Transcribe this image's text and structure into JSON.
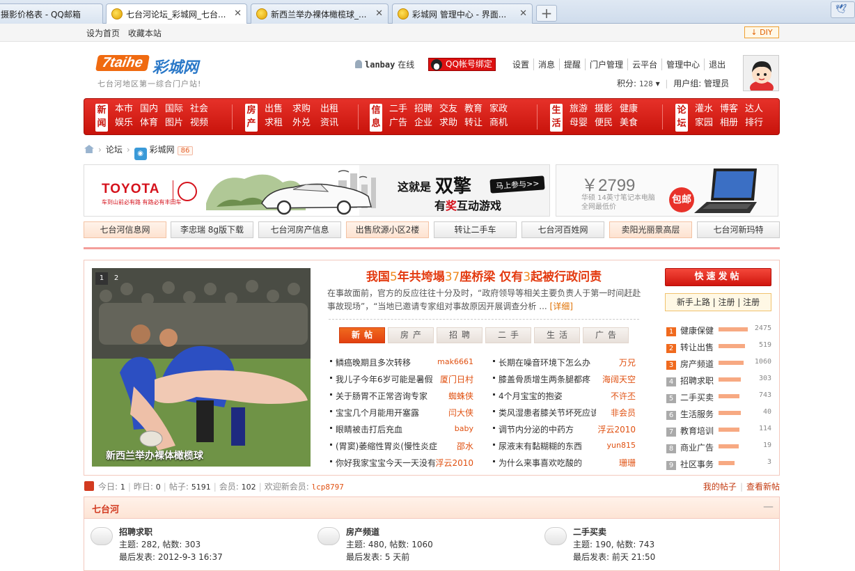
{
  "browser": {
    "tabs": [
      {
        "title": "摄影价格表 - QQ邮箱"
      },
      {
        "title": "七台河论坛_彩城网_七台..."
      },
      {
        "title": "新西兰举办裸体橄榄球_..."
      },
      {
        "title": "彩城网 管理中心 - 界面..."
      }
    ],
    "new_tab": "+"
  },
  "topbar": {
    "set_home": "设为首页",
    "bookmark": "收藏本站",
    "diy": "DIY"
  },
  "header": {
    "logo_brand": "7taihe",
    "logo_cn": "彩城网",
    "slogan": "七台河地区第一综合门户站!",
    "username": "lanbay",
    "status": "在线",
    "qq_bind": "QQ帐号绑定",
    "nav_links": [
      "设置",
      "消息",
      "提醒",
      "门户管理",
      "云平台",
      "管理中心",
      "退出"
    ],
    "score_label": "积分:",
    "score_value": "128",
    "group_label": "用户组:",
    "group_value": "管理员"
  },
  "main_nav": [
    {
      "category": "新闻",
      "items": [
        "本市",
        "国内",
        "国际",
        "社会",
        "娱乐",
        "体育",
        "图片",
        "视频"
      ]
    },
    {
      "category": "房产",
      "items": [
        "出售",
        "求购",
        "出租",
        "求租",
        "外兑",
        "资讯"
      ]
    },
    {
      "category": "信息",
      "items": [
        "二手",
        "招聘",
        "交友",
        "教育",
        "家政",
        "广告",
        "企业",
        "求助",
        "转让",
        "商机"
      ]
    },
    {
      "category": "生活",
      "items": [
        "旅游",
        "摄影",
        "健康",
        "母婴",
        "便民",
        "美食"
      ]
    },
    {
      "category": "论坛",
      "items": [
        "灌水",
        "博客",
        "达人",
        "家园",
        "相册",
        "排行"
      ]
    }
  ],
  "breadcrumb": {
    "forum": "论坛",
    "site": "彩城网",
    "count": "86"
  },
  "ads": {
    "brand": "TOYOTA",
    "brand_sub": "车到山前必有路 有路必有丰田车",
    "headline_a": "这就是",
    "headline_b": "双擎",
    "headline_c": "有奖互动游戏",
    "headline_c_red": "奖",
    "cta": "马上参与>>",
    "price": "￥2799",
    "price_sub1": "华硕 14英寸笔记本电脑",
    "price_sub2": "全网最低价",
    "badge": "包邮"
  },
  "quick_links": [
    "七台河信息网",
    "李忠瑞 8g版下载",
    "七台河房产信息",
    "出售欣源小区2楼",
    "转让二手车",
    "七台河百姓网",
    "卖阳光丽景高层",
    "七台河新玛特"
  ],
  "slideshow": {
    "caption": "新西兰举办裸体橄榄球",
    "pages": [
      "1",
      "2"
    ]
  },
  "feature": {
    "headline": "我国5年共垮塌37座桥梁 仅有3起被行政问责",
    "summary": "在事故面前，官方的反应往往十分及时，“政府领导等相关主要负责人于第一时间赶赴事故现场”，“当地已邀请专家组对事故原因开展调查分析 ...",
    "more": "[详细]"
  },
  "content_tabs": [
    "新帖",
    "房产",
    "招聘",
    "二手",
    "生活",
    "广告"
  ],
  "posts_left": [
    {
      "title": "鳞癌晚期且多次转移",
      "author": "mak6661"
    },
    {
      "title": "我儿子今年6岁可能是暑假",
      "author": "厦门日村"
    },
    {
      "title": "关于肠胃不正常咨询专家",
      "author": "蜘蛛侠"
    },
    {
      "title": "宝宝几个月能用开塞露",
      "author": "闫大侠"
    },
    {
      "title": "眼睛被击打后充血",
      "author": "baby"
    },
    {
      "title": "(胃窦)萎缩性胃炎(慢性炎症",
      "author": "邵水"
    },
    {
      "title": "你好我家宝宝今天一天没有",
      "author": "浮云2010"
    }
  ],
  "posts_right": [
    {
      "title": "长期在噪音环境下怎么办",
      "author": "万兄"
    },
    {
      "title": "膝盖骨质增生两条腿都疼",
      "author": "海阔天空"
    },
    {
      "title": "4个月宝宝的抱姿",
      "author": "不许丕"
    },
    {
      "title": "类风湿患者膝关节坏死应该是",
      "author": "非会员"
    },
    {
      "title": "调节内分泌的中药方",
      "author": "浮云2010"
    },
    {
      "title": "尿液末有黏糊糊的东西",
      "author": "yun815"
    },
    {
      "title": "为什么来事喜欢吃酸的",
      "author": "珊珊"
    }
  ],
  "sidebar": {
    "post_button": "快速发帖",
    "reg_bar": "新手上路 | 注册 | 注册",
    "rankings": [
      {
        "rank": "1",
        "name": "健康保健",
        "count": "2475",
        "fill": 1.0
      },
      {
        "rank": "2",
        "name": "转让出售",
        "count": "519",
        "fill": 0.9
      },
      {
        "rank": "3",
        "name": "房产频道",
        "count": "1060",
        "fill": 0.85
      },
      {
        "rank": "4",
        "name": "招聘求职",
        "count": "303",
        "fill": 0.75
      },
      {
        "rank": "5",
        "name": "二手买卖",
        "count": "743",
        "fill": 0.72
      },
      {
        "rank": "6",
        "name": "生活服务",
        "count": "40",
        "fill": 0.75
      },
      {
        "rank": "7",
        "name": "教育培训",
        "count": "114",
        "fill": 0.72
      },
      {
        "rank": "8",
        "name": "商业广告",
        "count": "19",
        "fill": 0.68
      },
      {
        "rank": "9",
        "name": "社区事务",
        "count": "3",
        "fill": 0.55
      }
    ]
  },
  "stats": {
    "today_label": "今日:",
    "today": "1",
    "yesterday_label": "昨日:",
    "yesterday": "0",
    "posts_label": "帖子:",
    "posts": "5191",
    "members_label": "会员:",
    "members": "102",
    "welcome_label": "欢迎新会员:",
    "newest": "lcp8797",
    "my_posts": "我的帖子",
    "new_posts": "查看新帖"
  },
  "section": {
    "title": "七台河",
    "collapse": "—",
    "forums": [
      {
        "name": "招聘求职",
        "stat": "主题: 282, 帖数: 303",
        "last": "最后发表: 2012-9-3 16:37"
      },
      {
        "name": "房产频道",
        "stat": "主题: 480, 帖数: 1060",
        "last": "最后发表: 5 天前"
      },
      {
        "name": "二手买卖",
        "stat": "主题: 190, 帖数: 743",
        "last": "最后发表: 前天 21:50"
      }
    ]
  }
}
